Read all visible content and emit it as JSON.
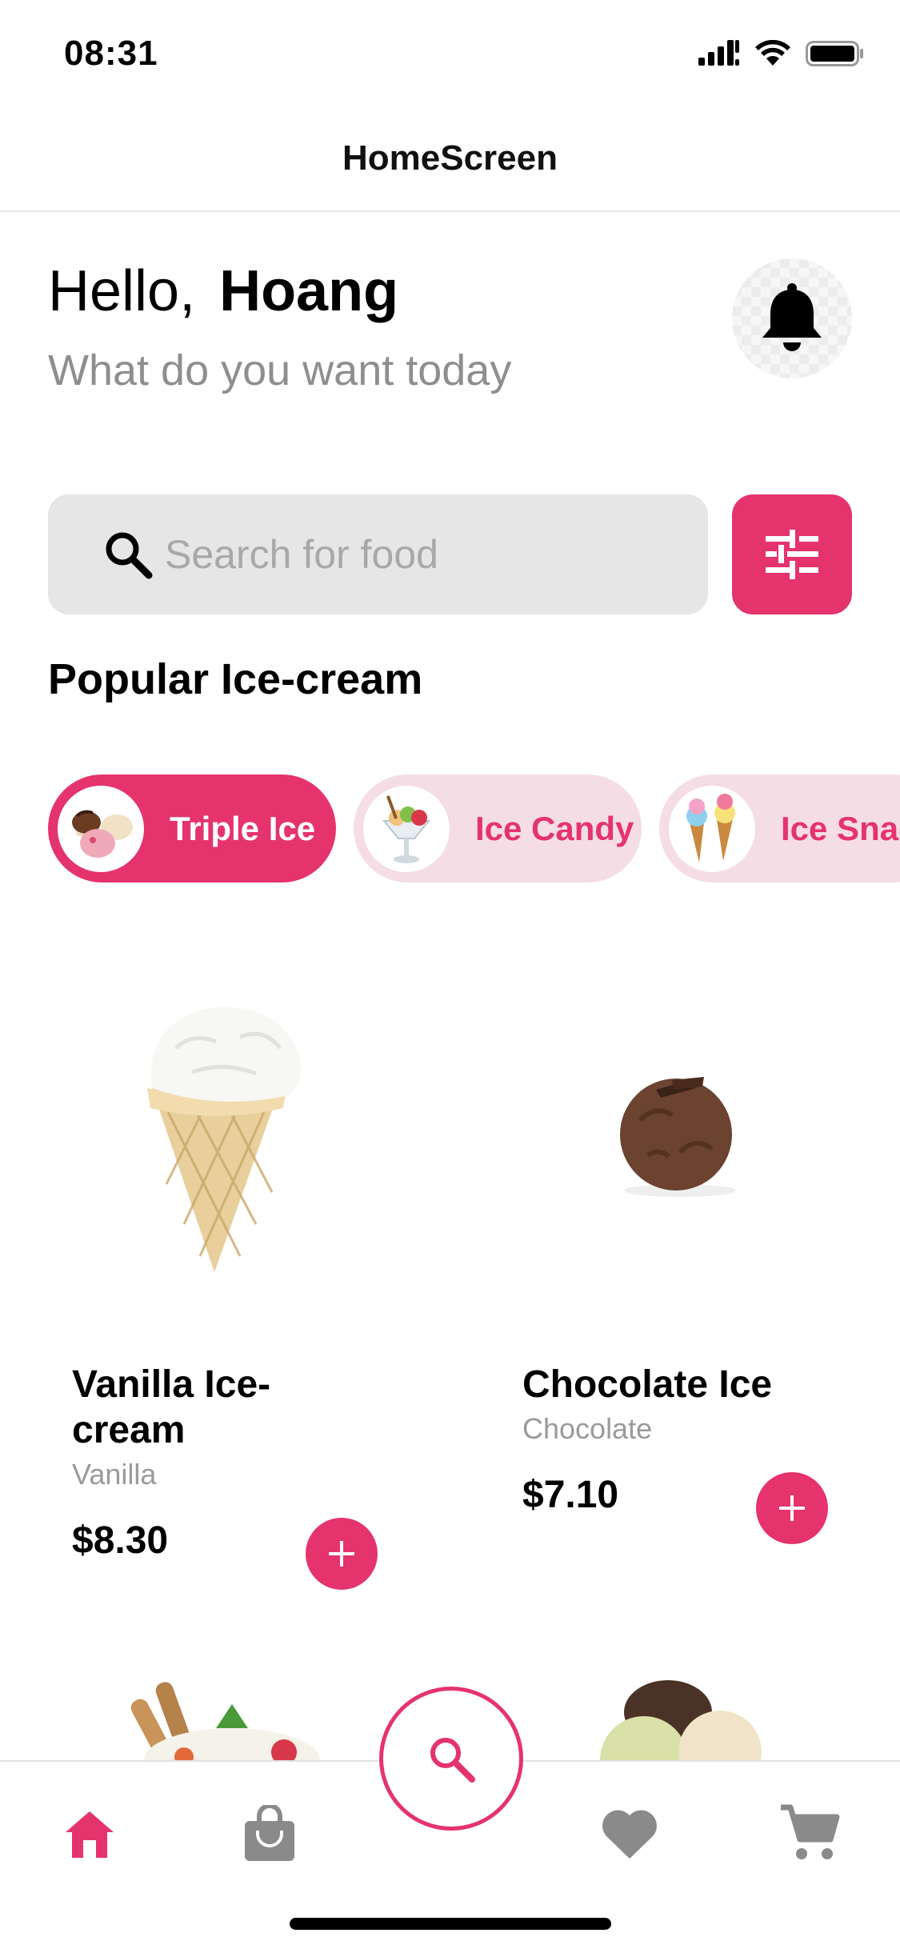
{
  "status_bar": {
    "time": "08:31"
  },
  "nav": {
    "title": "HomeScreen"
  },
  "greeting": {
    "hello": "Hello,",
    "name": "Hoang",
    "subtitle": "What do you want today"
  },
  "search": {
    "placeholder": "Search for food"
  },
  "section": {
    "title": "Popular Ice-cream"
  },
  "categories": [
    {
      "label": "Triple Ice",
      "active": true
    },
    {
      "label": "Ice Candy",
      "active": false
    },
    {
      "label": "Ice Snac",
      "active": false
    }
  ],
  "products": [
    {
      "name": "Vanilla Ice-cream",
      "flavor": "Vanilla",
      "price": "$8.30"
    },
    {
      "name": "Chocolate Ice",
      "flavor": "Chocolate",
      "price": "$7.10"
    }
  ],
  "tab_bar": {
    "items": [
      "home-icon",
      "bag-icon",
      "search-icon",
      "heart-icon",
      "cart-icon"
    ],
    "active": "home-icon"
  },
  "colors": {
    "accent": "#e5336d",
    "chip_inactive": "#f5dde5",
    "search_bg": "#e6e6e6",
    "muted_text": "#8e8e8e",
    "tab_icon": "#8a8a8a"
  }
}
